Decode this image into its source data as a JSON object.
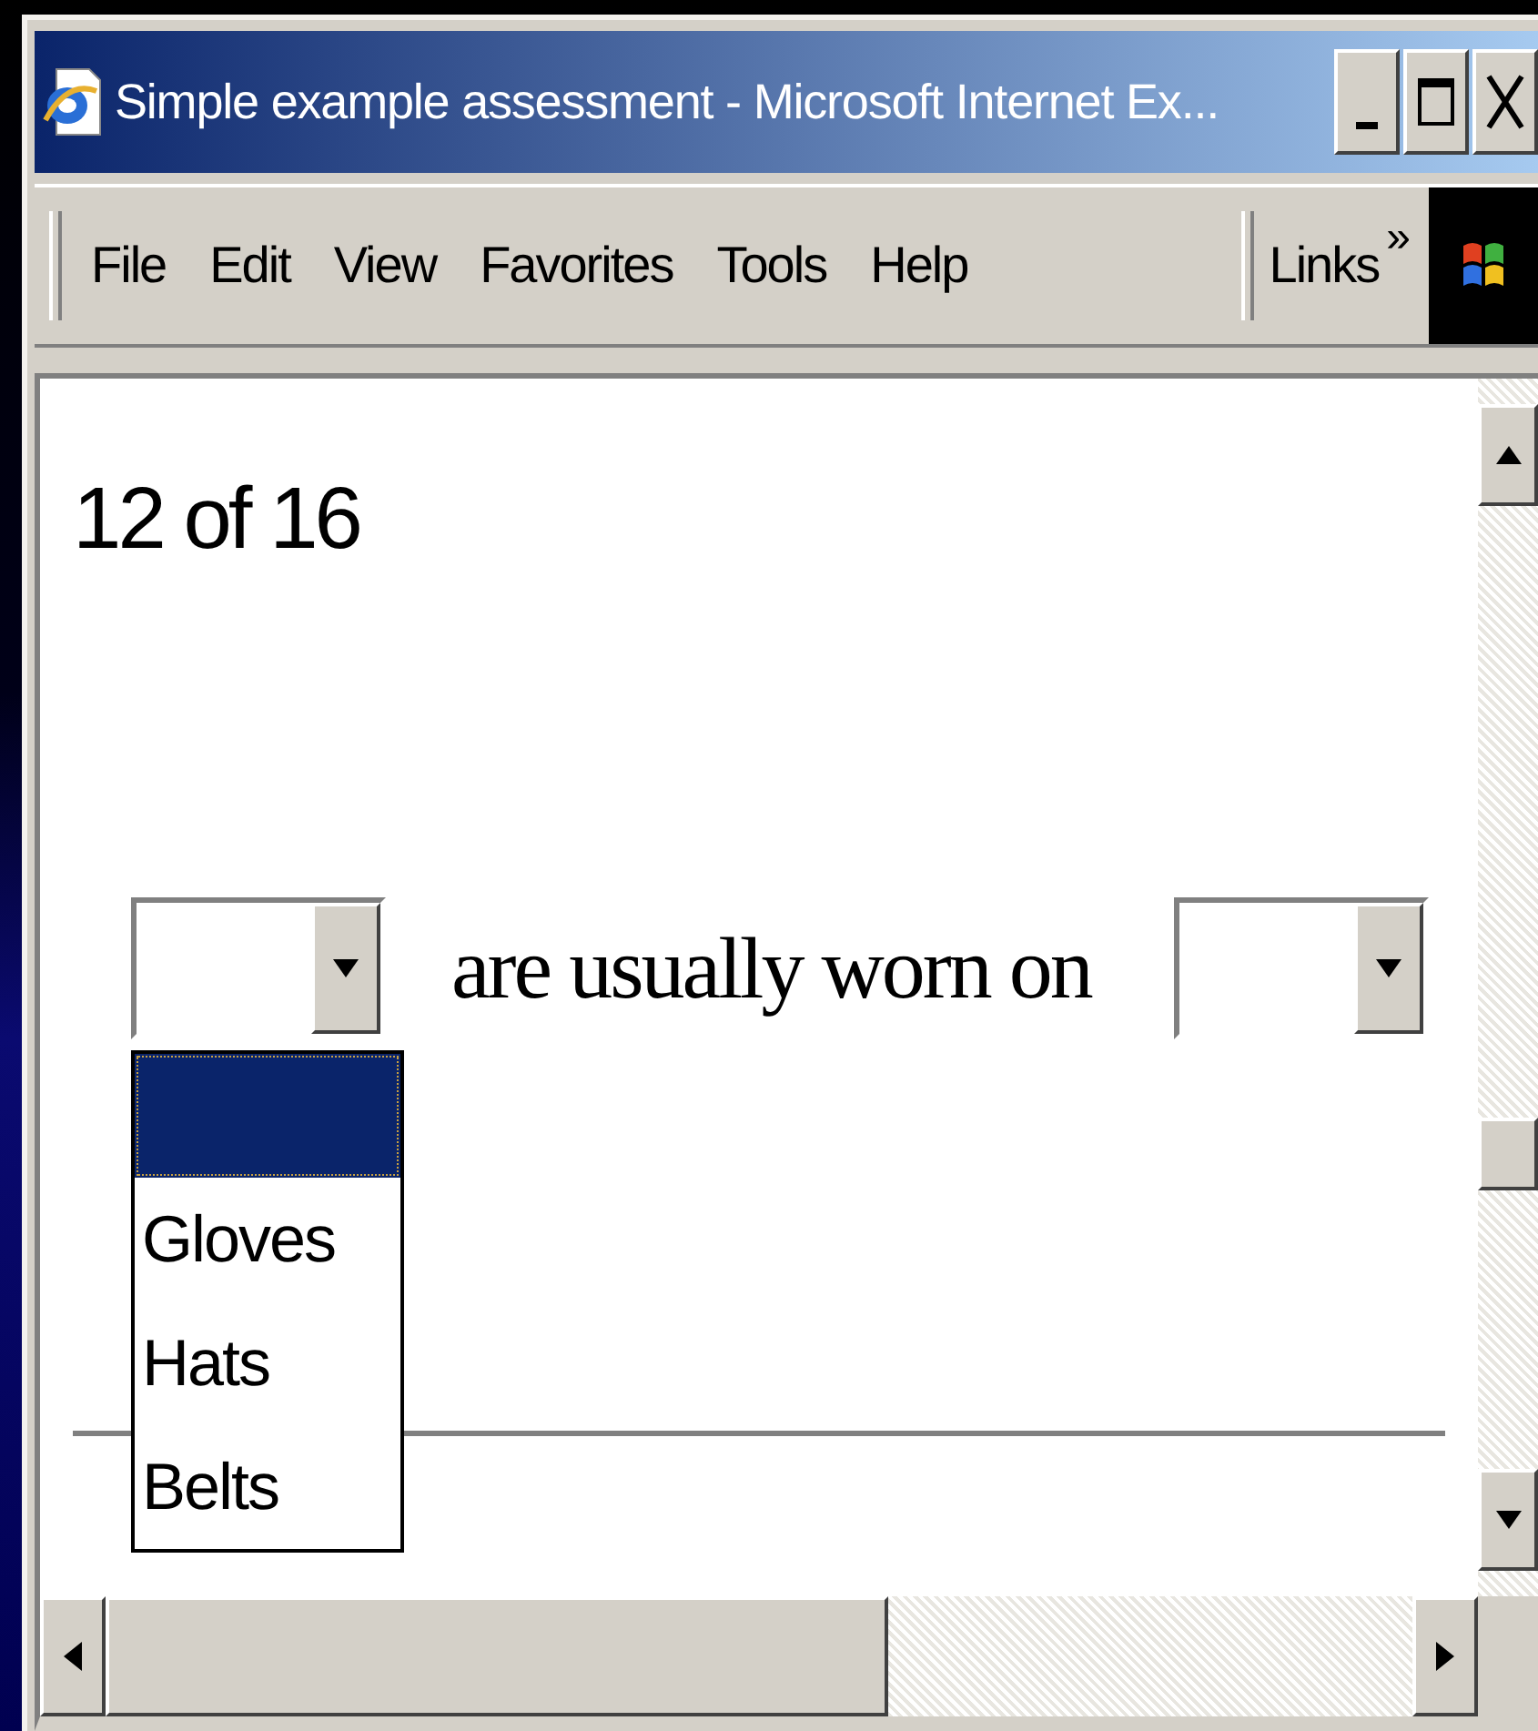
{
  "window": {
    "title": "Simple example assessment - Microsoft Internet Ex..."
  },
  "menu": [
    {
      "label": "File"
    },
    {
      "label": "Edit"
    },
    {
      "label": "View"
    },
    {
      "label": "Favorites"
    },
    {
      "label": "Tools"
    },
    {
      "label": "Help"
    }
  ],
  "links": {
    "label": "Links",
    "chevron": "»"
  },
  "page": {
    "counter": "12 of 16",
    "sentence": "are usually worn on",
    "dropdowns": [
      {
        "open": true,
        "options": [
          {
            "selected": true
          },
          {
            "label": "Gloves",
            "selected": false
          },
          {
            "label": "Hats",
            "selected": false
          },
          {
            "label": "Belts",
            "selected": false
          }
        ]
      },
      {
        "open": false
      }
    ]
  }
}
